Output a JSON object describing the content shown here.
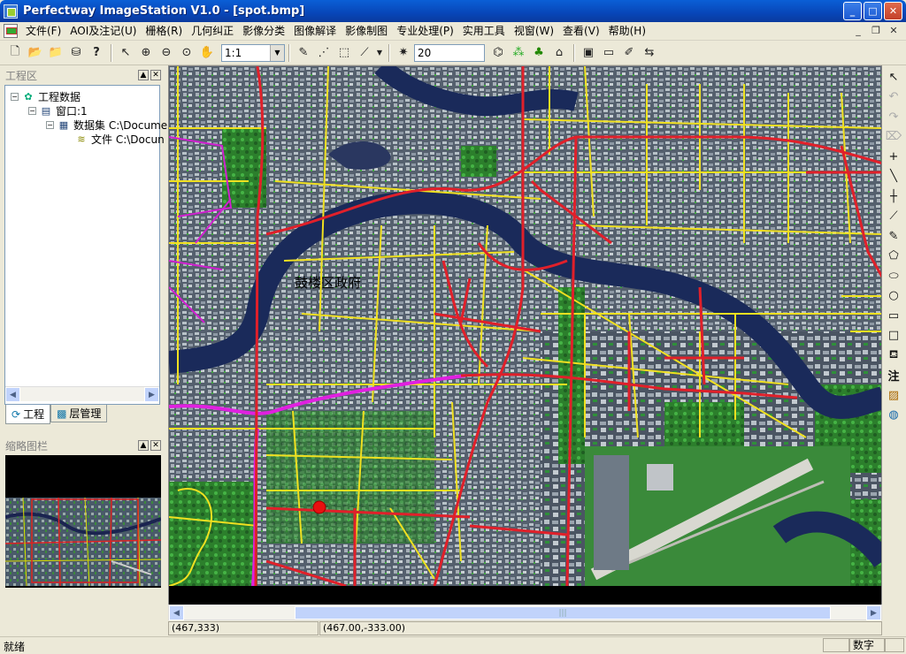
{
  "window": {
    "title": "Perfectway ImageStation V1.0 - [spot.bmp]",
    "btn_min": "_",
    "btn_max": "□",
    "btn_close": "✕"
  },
  "menu": [
    "文件(F)",
    "AOI及注记(U)",
    "栅格(R)",
    "几何纠正",
    "影像分类",
    "图像解译",
    "影像制图",
    "专业处理(P)",
    "实用工具",
    "视窗(W)",
    "查看(V)",
    "帮助(H)"
  ],
  "toolbar": {
    "scale_value": "1:1",
    "buffer_value": "20"
  },
  "project_panel": {
    "title": "工程区",
    "tab_project": "工程",
    "tab_layers": "层管理"
  },
  "tree": {
    "root": "工程数据",
    "window": "窗口:1",
    "dataset": "数据集 C:\\Docume",
    "file": "文件 C:\\Docun"
  },
  "thumbnail_panel": {
    "title": "缩略图栏"
  },
  "map": {
    "label": "鼓楼区政府"
  },
  "coords": {
    "pixel": "(467,333)",
    "geo": "(467.00,-333.00)"
  },
  "status": {
    "text": "就绪",
    "mode": "数字"
  },
  "colors": {
    "titlebar": "#0846b8",
    "road_red": "#e0202a",
    "road_yellow": "#f0e020",
    "road_magenta": "#e020e0",
    "river": "#1a2a5a"
  },
  "icons": {
    "toolbar": [
      "new-file-icon",
      "open-folder-icon",
      "open-project-icon",
      "save-icon",
      "help-icon",
      "pointer-icon",
      "zoom-in-icon",
      "zoom-out-icon",
      "zoom-fit-icon",
      "pan-hand-icon",
      "digitize-icon",
      "snap-icon",
      "edit-vertex-icon",
      "line-tool-icon",
      "magic-wand-icon",
      "transform-icon",
      "tree-icon",
      "home-icon",
      "layout-icon",
      "window-icon",
      "map-edit-icon",
      "export-icon"
    ],
    "right": [
      "select-arrow-icon",
      "undo-icon",
      "redo-icon",
      "delete-icon",
      "point-icon",
      "line-icon",
      "cross-icon",
      "polyline-icon",
      "freehand-icon",
      "polygon-icon",
      "ellipse-icon",
      "circle-icon",
      "rectangle-icon",
      "square-icon",
      "fill-icon",
      "annotation-icon",
      "image-icon",
      "globe-icon"
    ]
  }
}
